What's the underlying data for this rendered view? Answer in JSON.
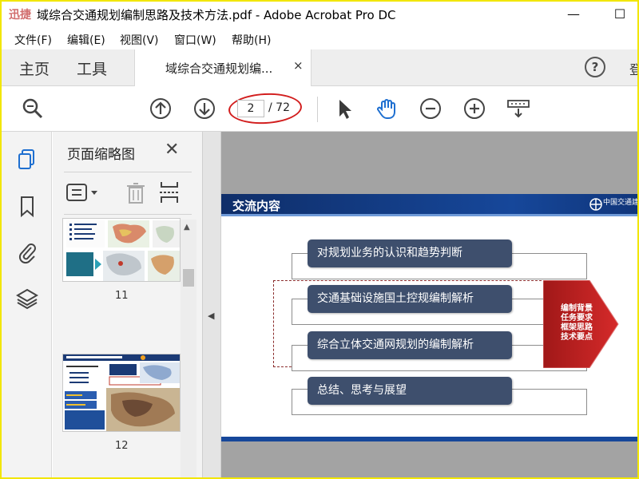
{
  "window": {
    "logo_text": "迅捷",
    "title": "域综合交通规划编制思路及技术方法.pdf - Adobe Acrobat Pro DC",
    "minimize": "—",
    "maximize": "☐"
  },
  "menu": {
    "items": [
      {
        "label": "文件(F)"
      },
      {
        "label": "编辑(E)"
      },
      {
        "label": "视图(V)"
      },
      {
        "label": "窗口(W)"
      },
      {
        "label": "帮助(H)"
      }
    ]
  },
  "tabs": {
    "home": "主页",
    "tools": "工具",
    "doc_tab": "域综合交通规划编...",
    "close": "×",
    "help": "?",
    "partial": "登"
  },
  "toolbar": {
    "current_page": "2",
    "total_pages": "/ 72"
  },
  "thumbnails": {
    "panel_title": "页面缩略图",
    "close": "✕",
    "items": [
      {
        "page": "11"
      },
      {
        "page": "12"
      }
    ]
  },
  "slide": {
    "title": "交流内容",
    "org": "中国交通建",
    "bars": [
      "对规划业务的认识和趋势判断",
      "交通基础设施国土控规编制解析",
      "综合立体交通网规划的编制解析",
      "总结、思考与展望"
    ],
    "arrow_lines": [
      "编制背景",
      "任务要求",
      "框架思路",
      "技术要点"
    ]
  },
  "colors": {
    "accent_red": "#d21e1e",
    "slide_header_blue": "#16479a",
    "bar_fill": "#3e4f6d",
    "window_border": "#f2e600"
  }
}
